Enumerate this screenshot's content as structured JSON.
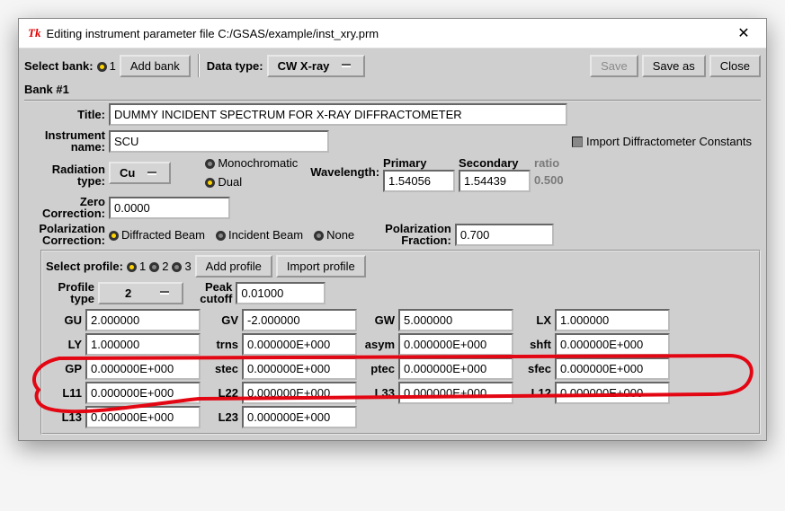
{
  "window": {
    "title": "Editing instrument parameter file C:/GSAS/example/inst_xry.prm"
  },
  "toolbar": {
    "select_bank_label": "Select bank:",
    "bank_radio": "1",
    "add_bank": "Add bank",
    "data_type_label": "Data type:",
    "data_type_value": "CW X-ray",
    "save": "Save",
    "save_as": "Save as",
    "close": "Close"
  },
  "bank": {
    "header": "Bank #1",
    "title_label": "Title:",
    "title_value": "DUMMY INCIDENT SPECTRUM FOR X-RAY DIFFRACTOMETER",
    "instr_name_label_1": "Instrument",
    "instr_name_label_2": "name:",
    "instr_name_value": "SCU",
    "import_diff": "Import Diffractometer Constants"
  },
  "radiation": {
    "label_1": "Radiation",
    "label_2": "type:",
    "element": "Cu",
    "mono": "Monochromatic",
    "dual": "Dual",
    "wavelength_label": "Wavelength:",
    "primary_label": "Primary",
    "secondary_label": "Secondary",
    "ratio_label": "ratio",
    "primary_value": "1.54056",
    "secondary_value": "1.54439",
    "ratio_value": "0.500"
  },
  "zero": {
    "label_1": "Zero",
    "label_2": "Correction:",
    "value": "0.0000"
  },
  "polarization": {
    "label_1": "Polarization",
    "label_2": "Correction:",
    "diffracted": "Diffracted Beam",
    "incident": "Incident Beam",
    "none": "None",
    "fraction_label_1": "Polarization",
    "fraction_label_2": "Fraction:",
    "fraction_value": "0.700"
  },
  "profile_select": {
    "label": "Select profile:",
    "p1": "1",
    "p2": "2",
    "p3": "3",
    "add": "Add profile",
    "import": "Import profile"
  },
  "profile": {
    "type_label_1": "Profile",
    "type_label_2": "type",
    "type_value": "2",
    "cutoff_label_1": "Peak",
    "cutoff_label_2": "cutoff",
    "cutoff_value": "0.01000"
  },
  "params": {
    "GU": "2.000000",
    "GV": "-2.000000",
    "GW": "5.000000",
    "LX": "1.000000",
    "LY": "1.000000",
    "trns": "0.000000E+000",
    "asym": "0.000000E+000",
    "shft": "0.000000E+000",
    "GP": "0.000000E+000",
    "stec": "0.000000E+000",
    "ptec": "0.000000E+000",
    "sfec": "0.000000E+000",
    "L11": "0.000000E+000",
    "L22": "0.000000E+000",
    "L33": "0.000000E+000",
    "L12": "0.000000E+000",
    "L13": "0.000000E+000",
    "L23": "0.000000E+000"
  },
  "param_labels": {
    "GU": "GU",
    "GV": "GV",
    "GW": "GW",
    "LX": "LX",
    "LY": "LY",
    "trns": "trns",
    "asym": "asym",
    "shft": "shft",
    "GP": "GP",
    "stec": "stec",
    "ptec": "ptec",
    "sfec": "sfec",
    "L11": "L11",
    "L22": "L22",
    "L33": "L33",
    "L12": "L12",
    "L13": "L13",
    "L23": "L23"
  }
}
